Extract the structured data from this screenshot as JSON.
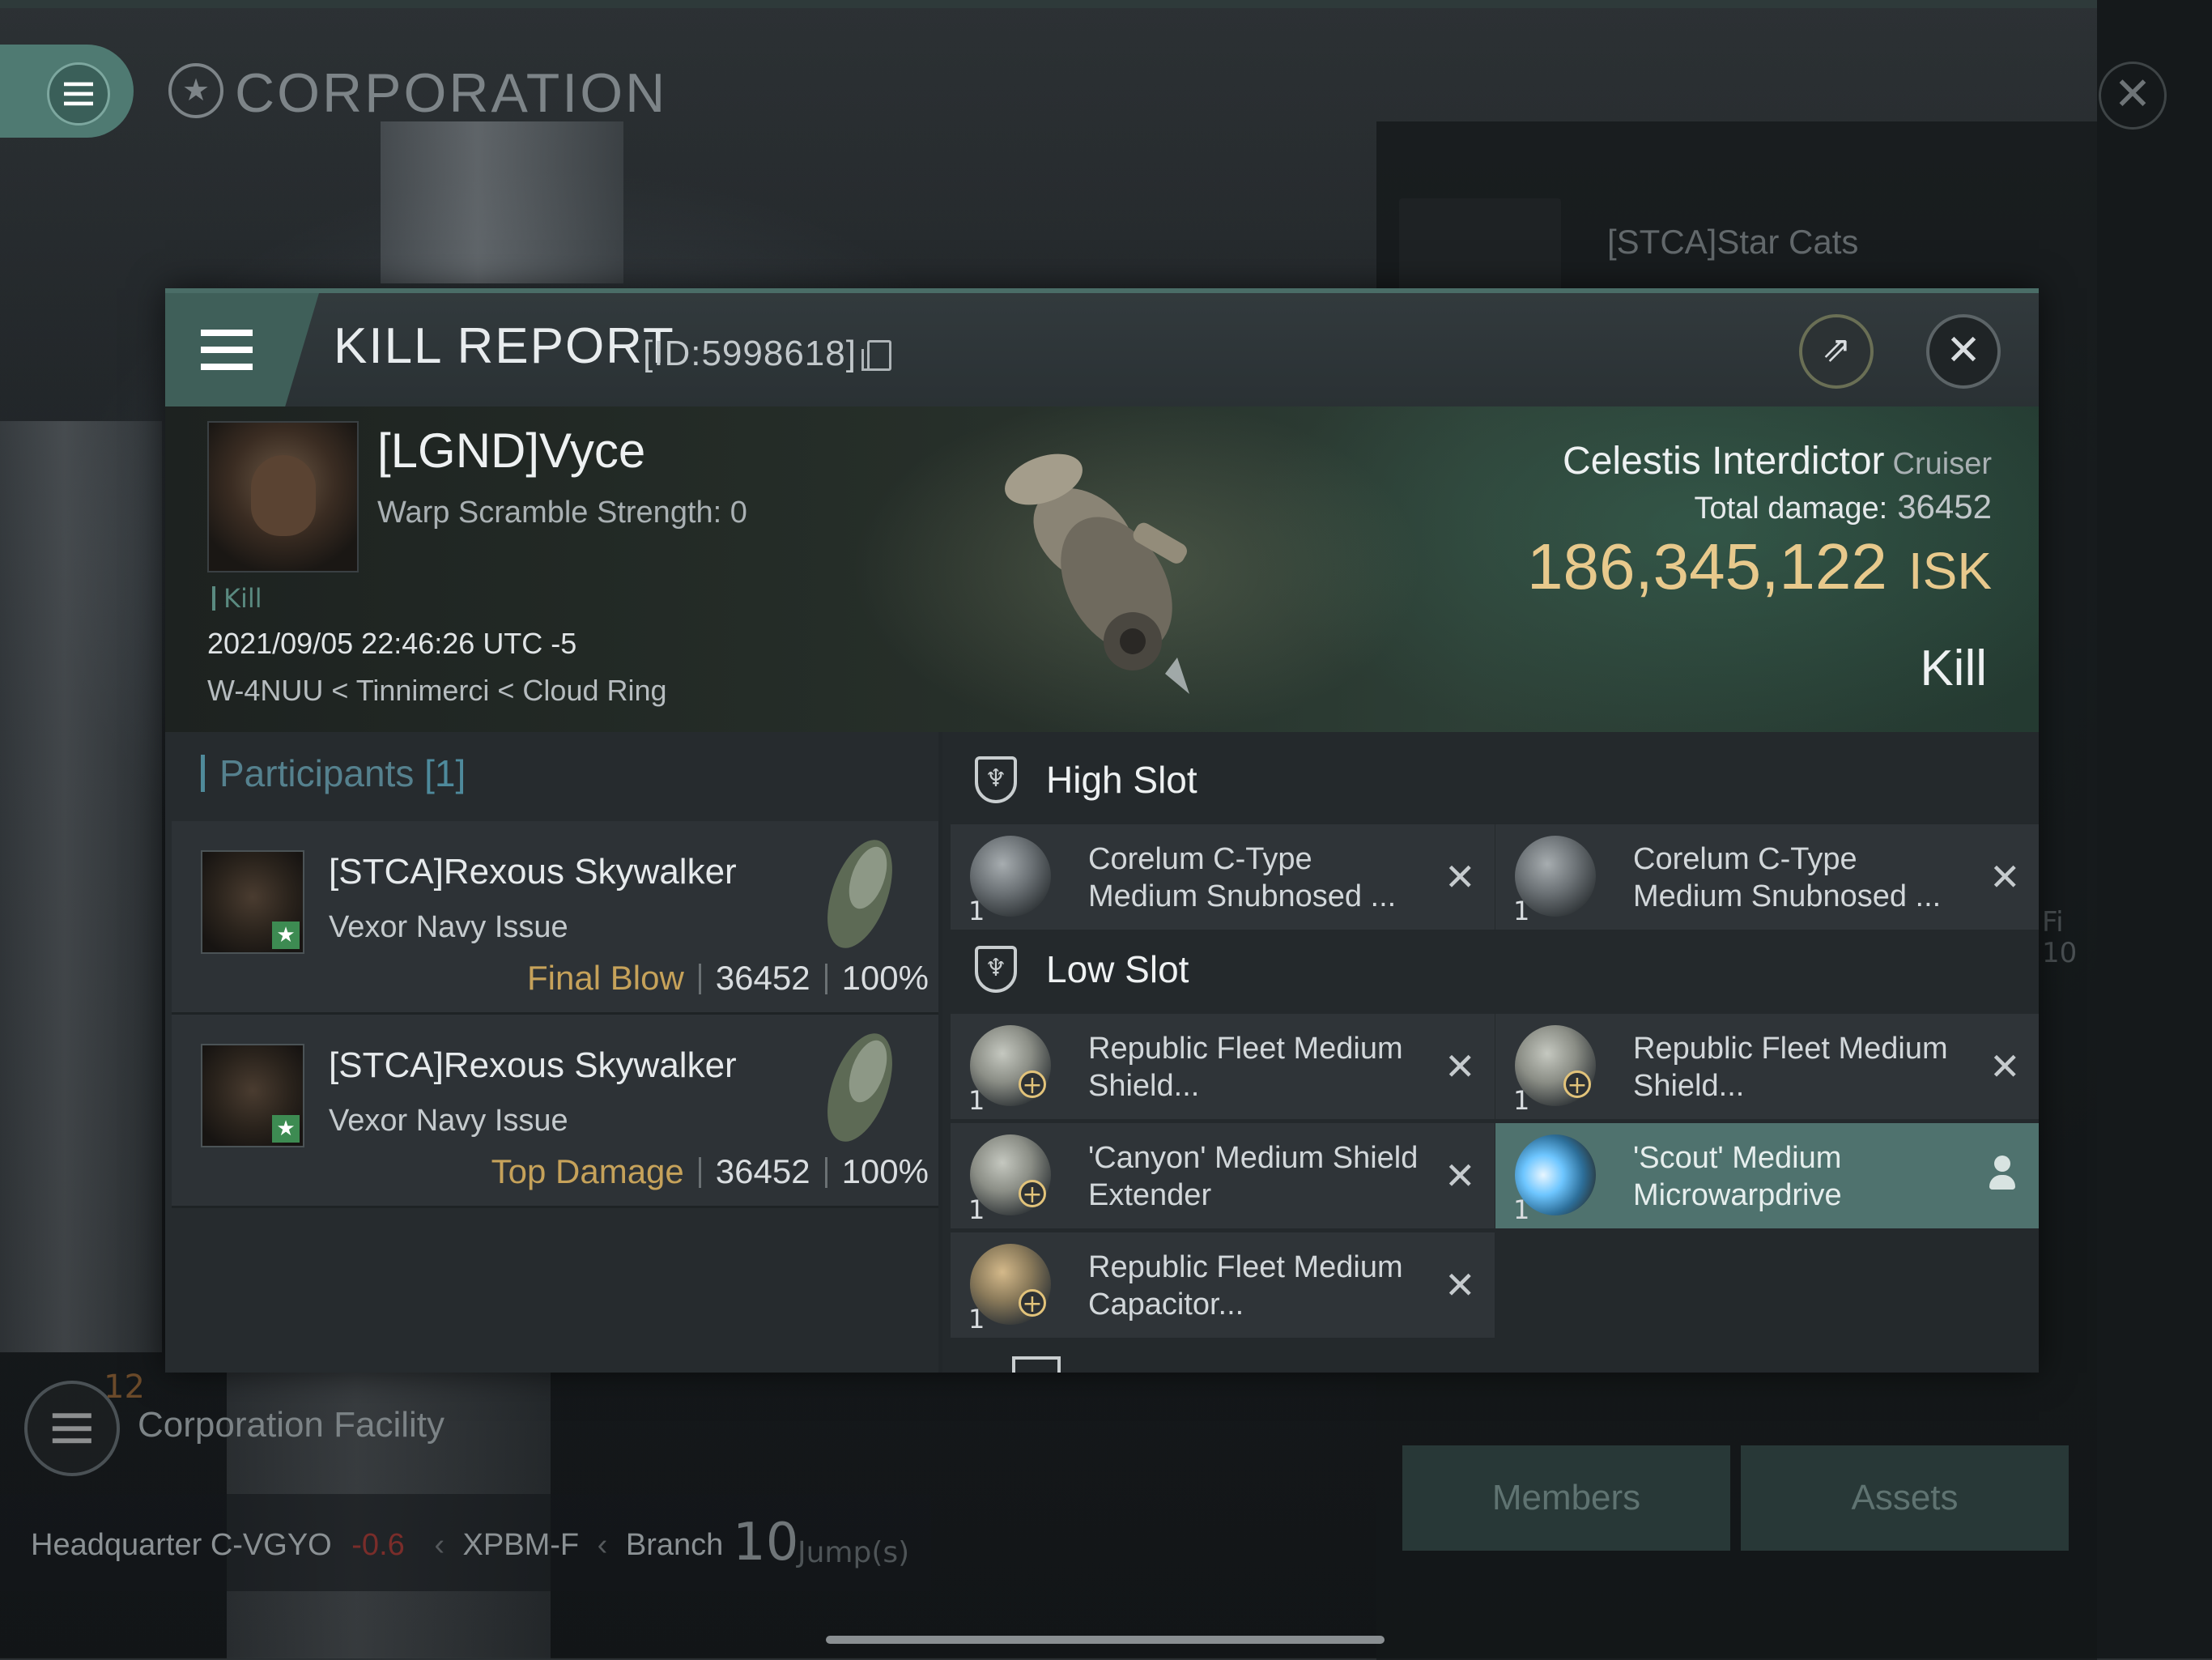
{
  "outer": {
    "title": "CORPORATION",
    "corp_name": "[STCA]Star Cats",
    "facility_count": "12",
    "facility_label": "Corporation Facility",
    "hq_prefix": "Headquarter",
    "hq_system": "C-VGYO",
    "hq_security": "-0.6",
    "hq_constellation": "XPBM-F",
    "hq_region": "Branch",
    "jumps": "10",
    "jumps_label": "Jump(s)",
    "buttons": {
      "members": "Members",
      "assets": "Assets"
    },
    "side_fragment_1": "Fi",
    "side_fragment_2": "10"
  },
  "report": {
    "title": "KILL REPORT",
    "id": "[ID:5998618]",
    "victim": {
      "name": "[LGND]Vyce",
      "warp_scramble": "Warp Scramble Strength: 0",
      "tag": "Kill",
      "date": "2021/09/05 22:46:26 UTC -5",
      "location": "W-4NUU < Tinnimerci < Cloud Ring"
    },
    "ship": {
      "name": "Celestis Interdictor",
      "class": "Cruiser",
      "total_damage_label": "Total damage:",
      "total_damage": "36452",
      "isk_value": "186,345,122",
      "isk_unit": "ISK",
      "result": "Kill"
    },
    "participants": {
      "label": "Participants",
      "count": "[1]",
      "rows": [
        {
          "name": "[STCA]Rexous Skywalker",
          "ship": "Vexor Navy Issue",
          "tag": "Final Blow",
          "damage": "36452",
          "percent": "100%"
        },
        {
          "name": "[STCA]Rexous Skywalker",
          "ship": "Vexor Navy Issue",
          "tag": "Top Damage",
          "damage": "36452",
          "percent": "100%"
        }
      ]
    },
    "slots": {
      "high": {
        "label": "High Slot",
        "modules": [
          {
            "qty": "1",
            "name": "Corelum C-Type Medium Snubnosed ...",
            "icon": "turret-icon"
          },
          {
            "qty": "1",
            "name": "Corelum C-Type Medium Snubnosed ...",
            "icon": "turret-icon"
          }
        ]
      },
      "low": {
        "label": "Low Slot",
        "modules": [
          {
            "qty": "1",
            "name": "Republic Fleet Medium Shield...",
            "icon": "shield-extender-icon"
          },
          {
            "qty": "1",
            "name": "Republic Fleet Medium Shield...",
            "icon": "shield-extender-icon"
          },
          {
            "qty": "1",
            "name": "'Canyon' Medium Shield Extender",
            "icon": "shield-extender-icon"
          },
          {
            "qty": "1",
            "name": "'Scout' Medium Microwarpdrive",
            "icon": "microwarpdrive-icon"
          },
          {
            "qty": "1",
            "name": "Republic Fleet Medium Capacitor...",
            "icon": "capacitor-icon"
          }
        ]
      }
    }
  },
  "colors": {
    "accent": "#4f7a72",
    "isk_gold": "#e8c98c",
    "tag_gold": "#c6a25a",
    "participants_blue": "#55818e",
    "active_module": "#4f726e"
  }
}
